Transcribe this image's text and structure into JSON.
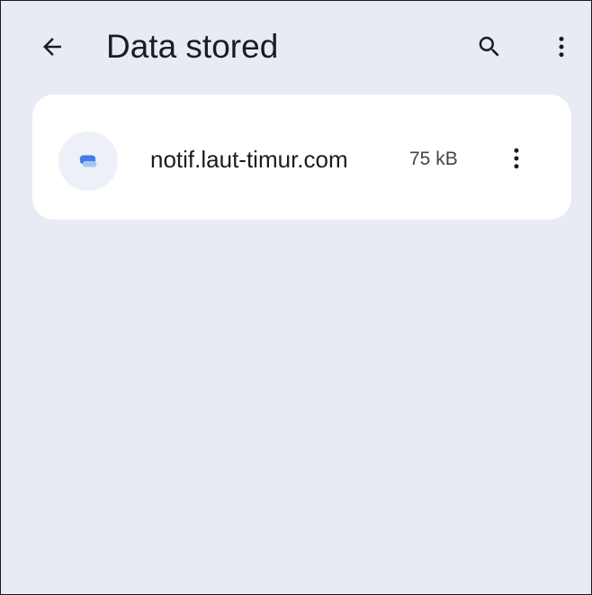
{
  "header": {
    "title": "Data stored",
    "back_icon": "arrow-back-icon",
    "search_icon": "search-icon",
    "more_icon": "more-vert-icon"
  },
  "sites": [
    {
      "name": "notif.laut-timur.com",
      "size": "75 kB",
      "icon": "chat-bubbles-icon",
      "menu_icon": "more-vert-icon"
    }
  ],
  "colors": {
    "background": "#e8ebf4",
    "card": "#ffffff",
    "text_primary": "#1c1c20",
    "text_secondary": "#42454d",
    "site_icon_accent": "#3f7de8"
  }
}
